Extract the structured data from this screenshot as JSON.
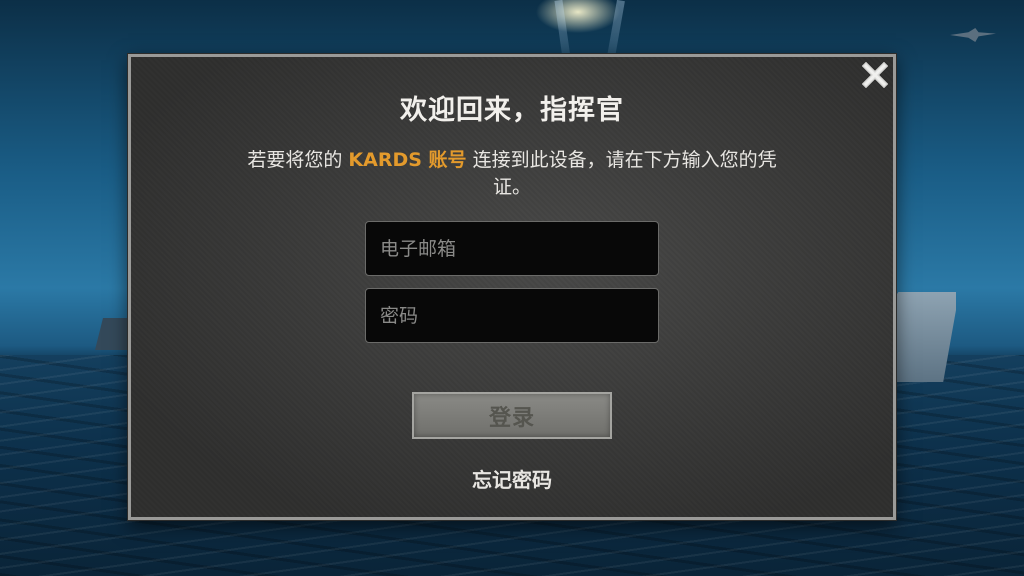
{
  "dialog": {
    "title": "欢迎回来，指挥官",
    "description_before": "若要将您的 ",
    "description_brand": "KARDS 账号",
    "description_after": " 连接到此设备，请在下方输入您的凭证。",
    "close_icon": "close-x-icon",
    "email_placeholder": "电子邮箱",
    "email_value": "",
    "password_placeholder": "密码",
    "password_value": "",
    "login_label": "登录",
    "forgot_label": "忘记密码"
  },
  "colors": {
    "brand_accent": "#e39a2c",
    "dialog_bg": "#3e3e3d",
    "button_disabled": "#7c7c78"
  }
}
